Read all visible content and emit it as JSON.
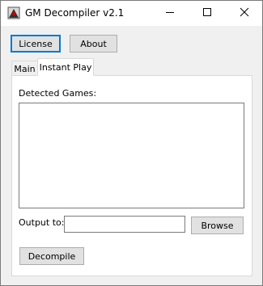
{
  "window": {
    "title": "GM Decompiler v2.1"
  },
  "toolbar": {
    "license_label": "License",
    "about_label": "About"
  },
  "tabs": [
    {
      "label": "Main",
      "active": false
    },
    {
      "label": "Instant Play",
      "active": true
    }
  ],
  "instant_play": {
    "detected_games_label": "Detected Games:",
    "detected_games": [],
    "output_label": "Output to:",
    "output_value": "",
    "browse_label": "Browse",
    "decompile_label": "Decompile"
  },
  "icons": {
    "app": "app-icon",
    "minimize": "minimize-icon",
    "maximize": "maximize-icon",
    "close": "close-icon"
  },
  "colors": {
    "default_button_border": "#0078d7",
    "button_face": "#e1e1e1",
    "window_bg": "#f0f0f0"
  }
}
